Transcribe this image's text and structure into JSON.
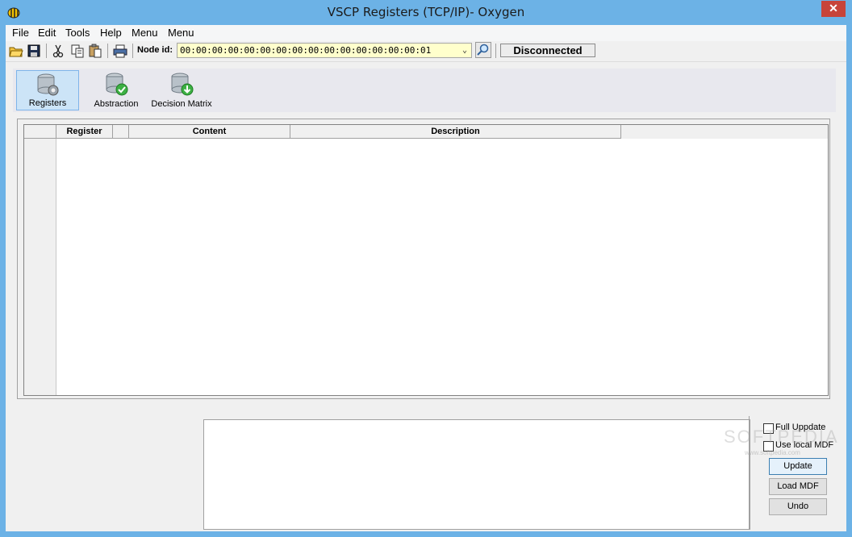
{
  "window": {
    "title": "VSCP Registers (TCP/IP)- Oxygen",
    "close_label": "✕"
  },
  "menu": [
    {
      "label": "File"
    },
    {
      "label": "Edit"
    },
    {
      "label": "Tools"
    },
    {
      "label": "Help"
    },
    {
      "label": "Menu"
    },
    {
      "label": "Menu"
    }
  ],
  "toolbar": {
    "icons": [
      "open-folder-icon",
      "save-icon",
      "cut-icon",
      "copy-icon",
      "paste-icon",
      "print-icon"
    ],
    "node_label": "Node id:",
    "node_value": "00:00:00:00:00:00:00:00:00:00:00:00:00:00:00:01",
    "status_button": "Disconnected"
  },
  "tabs": [
    {
      "label": "Registers",
      "icon": "database-gear-icon",
      "active": true
    },
    {
      "label": "Abstraction",
      "icon": "database-check-icon",
      "active": false
    },
    {
      "label": "Decision Matrix",
      "icon": "database-download-icon",
      "active": false
    }
  ],
  "grid": {
    "columns": [
      "Register",
      "",
      "Content",
      "Description"
    ],
    "rows": []
  },
  "side_panel": {
    "full_update_label": "Full Uppdate",
    "full_update_checked": false,
    "use_local_mdf_label": "Use local MDF",
    "use_local_mdf_checked": false,
    "update_button": "Update",
    "load_mdf_button": "Load MDF",
    "undo_button": "Undo"
  },
  "watermark": {
    "text": "SOFTPEDIA",
    "sub": "www.softpedia.com"
  }
}
